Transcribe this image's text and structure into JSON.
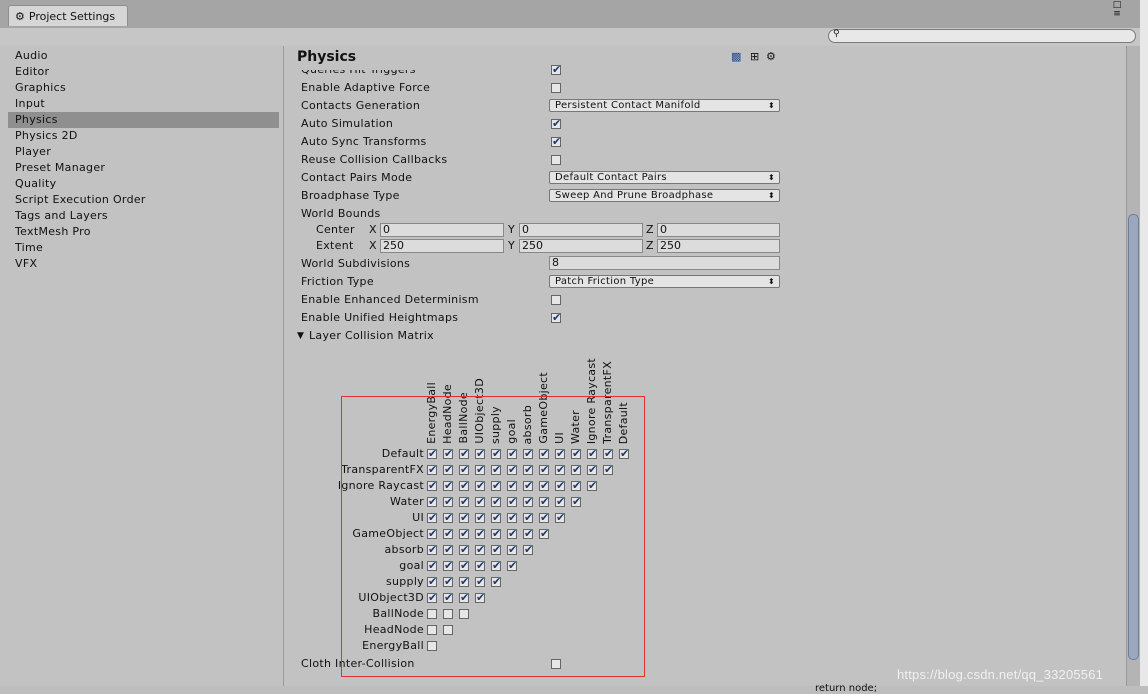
{
  "window": {
    "tab_title": "Project Settings"
  },
  "sidebar": {
    "items": [
      {
        "label": "Audio"
      },
      {
        "label": "Editor"
      },
      {
        "label": "Graphics"
      },
      {
        "label": "Input"
      },
      {
        "label": "Physics",
        "selected": true
      },
      {
        "label": "Physics 2D"
      },
      {
        "label": "Player"
      },
      {
        "label": "Preset Manager"
      },
      {
        "label": "Quality"
      },
      {
        "label": "Script Execution Order"
      },
      {
        "label": "Tags and Layers"
      },
      {
        "label": "TextMesh Pro"
      },
      {
        "label": "Time"
      },
      {
        "label": "VFX"
      }
    ]
  },
  "physics": {
    "title": "Physics",
    "settings": [
      {
        "label": "Queries Hit Triggers",
        "type": "check",
        "value": true
      },
      {
        "label": "Enable Adaptive Force",
        "type": "check",
        "value": false
      },
      {
        "label": "Contacts Generation",
        "type": "dropdown",
        "value": "Persistent Contact Manifold"
      },
      {
        "label": "Auto Simulation",
        "type": "check",
        "value": true
      },
      {
        "label": "Auto Sync Transforms",
        "type": "check",
        "value": true
      },
      {
        "label": "Reuse Collision Callbacks",
        "type": "check",
        "value": false
      },
      {
        "label": "Contact Pairs Mode",
        "type": "dropdown",
        "value": "Default Contact Pairs"
      },
      {
        "label": "Broadphase Type",
        "type": "dropdown",
        "value": "Sweep And Prune Broadphase"
      }
    ],
    "world_bounds": {
      "label": "World Bounds",
      "center_label": "Center",
      "extent_label": "Extent",
      "x": "X",
      "y": "Y",
      "z": "Z",
      "center": {
        "x": "0",
        "y": "0",
        "z": "0"
      },
      "extent": {
        "x": "250",
        "y": "250",
        "z": "250"
      }
    },
    "settings2": [
      {
        "label": "World Subdivisions",
        "type": "field",
        "value": "8"
      },
      {
        "label": "Friction Type",
        "type": "dropdown",
        "value": "Patch Friction Type"
      },
      {
        "label": "Enable Enhanced Determinism",
        "type": "check",
        "value": false
      },
      {
        "label": "Enable Unified Heightmaps",
        "type": "check",
        "value": true
      }
    ],
    "matrix": {
      "label": "Layer Collision Matrix",
      "layers": [
        "Default",
        "TransparentFX",
        "Ignore Raycast",
        "Water",
        "UI",
        "GameObject",
        "absorb",
        "goal",
        "supply",
        "UIObject3D",
        "BallNode",
        "HeadNode",
        "EnergyBall"
      ],
      "checked_rows": [
        13,
        12,
        11,
        10,
        9,
        8,
        7,
        6,
        5,
        4,
        0,
        0,
        0
      ]
    },
    "cloth_label": "Cloth Inter-Collision",
    "cloth_value": false
  },
  "watermark": "https://blog.csdn.net/qq_33205561",
  "code_snippet": "return node;"
}
